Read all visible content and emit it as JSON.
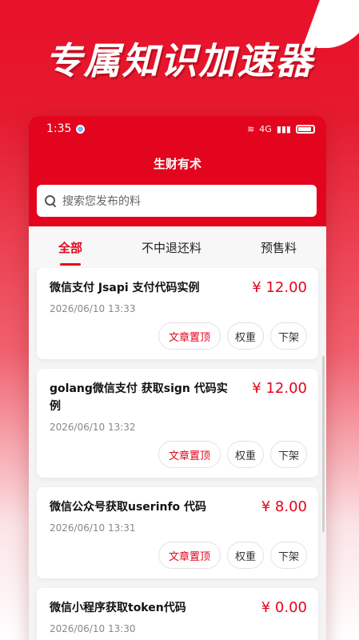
{
  "promo": {
    "headline": "专属知识加速器"
  },
  "status_bar": {
    "time": "1:35",
    "network": "4G"
  },
  "app": {
    "title": "生财有术"
  },
  "search": {
    "placeholder": "搜索您发布的料"
  },
  "tabs": [
    {
      "label": "全部",
      "active": true
    },
    {
      "label": "不中退还料",
      "active": false
    },
    {
      "label": "预售料",
      "active": false
    }
  ],
  "items": [
    {
      "title": "微信支付 Jsapi 支付代码实例",
      "price": "¥ 12.00",
      "time": "2026/06/10 13:33"
    },
    {
      "title": "golang微信支付 获取sign 代码实例",
      "price": "¥ 12.00",
      "time": "2026/06/10 13:32"
    },
    {
      "title": "微信公众号获取userinfo 代码",
      "price": "¥ 8.00",
      "time": "2026/06/10 13:31"
    },
    {
      "title": "微信小程序获取token代码",
      "price": "¥ 0.00",
      "time": "2026/06/10 13:30"
    }
  ],
  "actions": {
    "pin": "文章置顶",
    "weight": "权重",
    "unlist": "下架"
  },
  "colors": {
    "brand": "#e3051d",
    "price": "#e3051d"
  }
}
